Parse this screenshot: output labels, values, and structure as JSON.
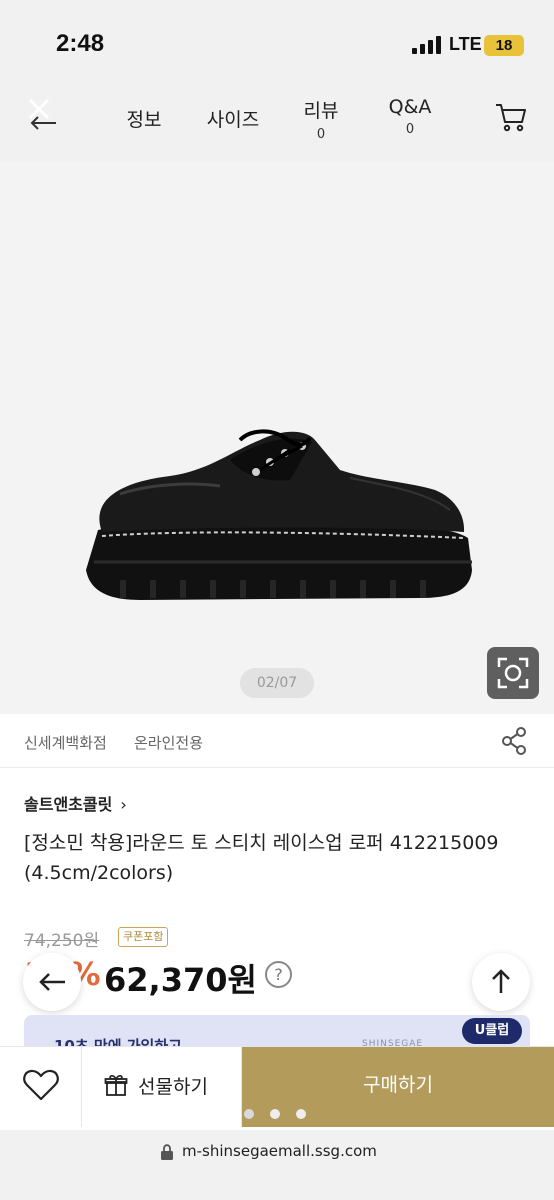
{
  "status_bar": {
    "time": "2:48",
    "network": "LTE",
    "battery": "18"
  },
  "nav": {
    "tabs": [
      {
        "label": "정보",
        "count": ""
      },
      {
        "label": "사이즈",
        "count": ""
      },
      {
        "label": "리뷰",
        "count": "0"
      },
      {
        "label": "Q&A",
        "count": "0"
      }
    ],
    "icons": {
      "back": "back-close-icon",
      "cart": "cart-icon"
    }
  },
  "gallery": {
    "page": "02/07",
    "lens_icon": "camera-search-icon"
  },
  "store": {
    "name": "신세계백화점",
    "tag": "온라인전용",
    "share_icon": "share-icon"
  },
  "product": {
    "brand": "솔트앤초콜릿",
    "brand_chevron": "›",
    "title": "[정소민 착용]라운드 토 스티치 레이스업 로퍼 412215009 (4.5cm/2colors)"
  },
  "pricing": {
    "original_price": "74,250원",
    "coupon_badge": "쿠폰포함",
    "discount": "16%",
    "price": "62,370원",
    "help": "?"
  },
  "promo": {
    "text": "10초 만에 가입하고",
    "brand": "SHINSEGAE",
    "badge": "U클럽"
  },
  "bottom": {
    "gift_label": "선물하기",
    "buy_label": "구매하기",
    "wish_icon": "heart-icon",
    "gift_icon": "gift-icon"
  },
  "url_bar": {
    "url": "m-shinsegaemall.ssg.com"
  },
  "colors": {
    "accent_gold": "#b39b5c",
    "discount": "#e26a3c",
    "uclub_navy": "#1f2a6b"
  }
}
